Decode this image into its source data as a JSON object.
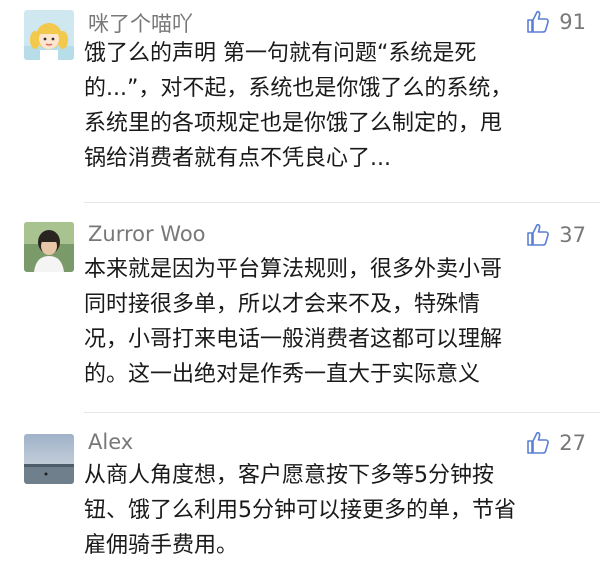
{
  "comments": [
    {
      "username": "咪了个喵吖",
      "likes": "91",
      "lines": [
        "饿了么的声明 第一句就有问题“系统是死",
        "的...”，对不起，系统也是你饿了么的系统，",
        "系统里的各项规定也是你饿了么制定的，甩",
        "锅给消费者就有点不凭良心了..."
      ]
    },
    {
      "username": "Zurror Woo",
      "likes": "37",
      "lines": [
        "本来就是因为平台算法规则，很多外卖小哥",
        "同时接很多单，所以才会来不及，特殊情",
        "况，小哥打来电话一般消费者这都可以理解",
        "的。这一出绝对是作秀一直大于实际意义"
      ]
    },
    {
      "username": "Alex",
      "likes": "27",
      "lines": [
        "从商人角度想，客户愿意按下多等5分钟按",
        "钮、饿了么利用5分钟可以接更多的单，节省",
        "雇佣骑手费用。"
      ]
    }
  ]
}
